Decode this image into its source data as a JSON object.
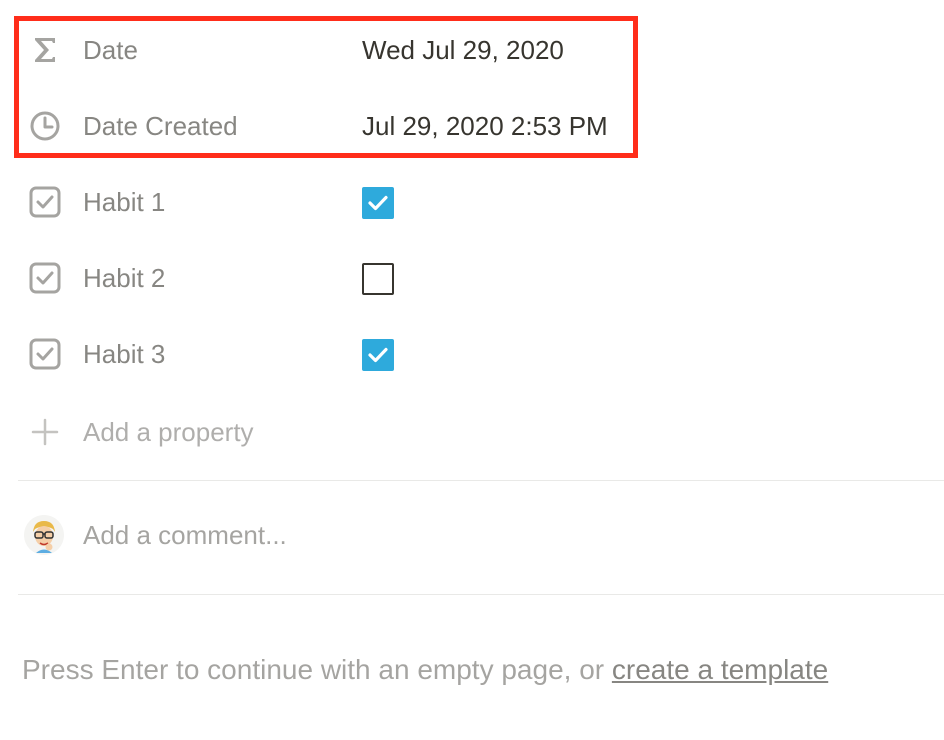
{
  "properties": {
    "date": {
      "label": "Date",
      "value": "Wed Jul 29, 2020",
      "icon": "sigma-icon"
    },
    "date_created": {
      "label": "Date Created",
      "value": "Jul 29, 2020 2:53 PM",
      "icon": "clock-icon"
    },
    "habits": [
      {
        "label": "Habit 1",
        "checked": true
      },
      {
        "label": "Habit 2",
        "checked": false
      },
      {
        "label": "Habit 3",
        "checked": true
      }
    ]
  },
  "add_property": {
    "label": "Add a property",
    "icon": "plus-icon"
  },
  "comment": {
    "placeholder": "Add a comment...",
    "icon": "avatar"
  },
  "footer": {
    "text": "Press Enter to continue with an empty page, or ",
    "link": "create a template"
  },
  "colors": {
    "highlight": "#ff2d1a",
    "checkbox_checked": "#2eaadc",
    "text": "#37352f"
  }
}
